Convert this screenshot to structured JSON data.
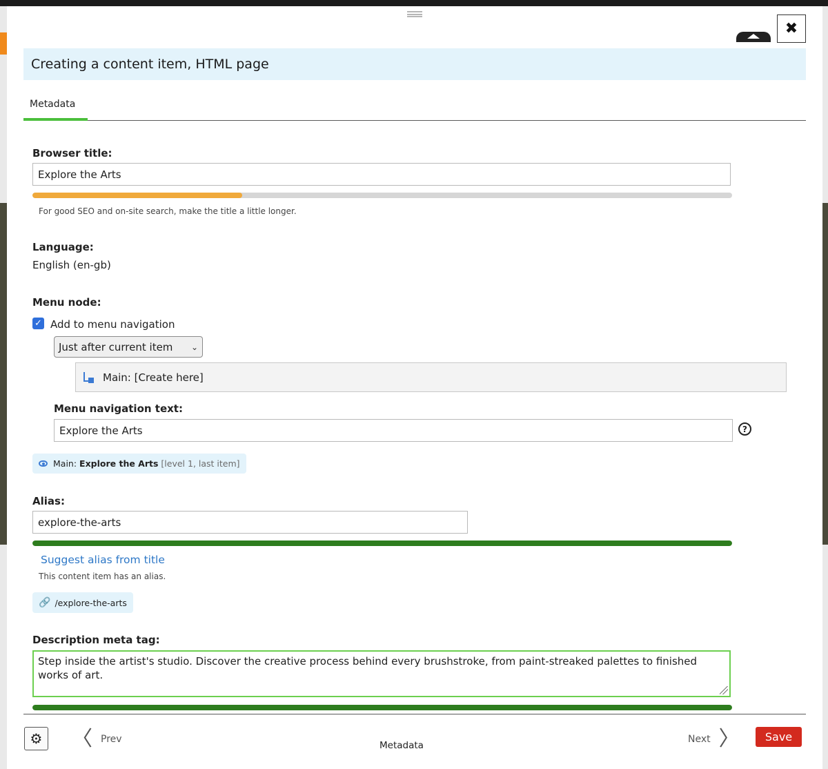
{
  "dialog": {
    "title": "Creating a content item, HTML page",
    "close_glyph": "✖",
    "tabs": [
      {
        "label": "Metadata"
      }
    ]
  },
  "browser_title": {
    "label": "Browser title:",
    "value": "Explore the Arts",
    "progress": 0.3,
    "progress_color": "#f0a93b",
    "hint": "For good SEO and on-site search, make the title a little longer."
  },
  "language": {
    "label": "Language:",
    "value": "English (en-gb)"
  },
  "menu_node": {
    "label": "Menu node:",
    "checkbox_label": "Add to menu navigation",
    "checked": true,
    "position_select": "Just after current item",
    "tree_item": "Main: [Create here]",
    "nav_text_label": "Menu navigation text:",
    "nav_text_value": "Explore the Arts",
    "help_glyph": "?",
    "preview": {
      "prefix": "Main:",
      "name": "Explore the Arts",
      "detail": "[level 1, last item]"
    }
  },
  "alias": {
    "label": "Alias:",
    "value": "explore-the-arts",
    "progress": 1.0,
    "progress_color": "#2e7d1e",
    "suggest_link": "Suggest alias from title",
    "hint": "This content item has an alias.",
    "path": "/explore-the-arts"
  },
  "description": {
    "label": "Description meta tag:",
    "value": "Step inside the artist's studio. Discover the creative process behind every brushstroke, from paint-streaked palettes to finished works of art.",
    "progress": 1.0,
    "progress_color": "#2e7d1e"
  },
  "footer": {
    "prev_label": "Prev",
    "current_label": "Metadata",
    "next_label": "Next",
    "save_label": "Save",
    "save_color": "#d32a1e"
  }
}
